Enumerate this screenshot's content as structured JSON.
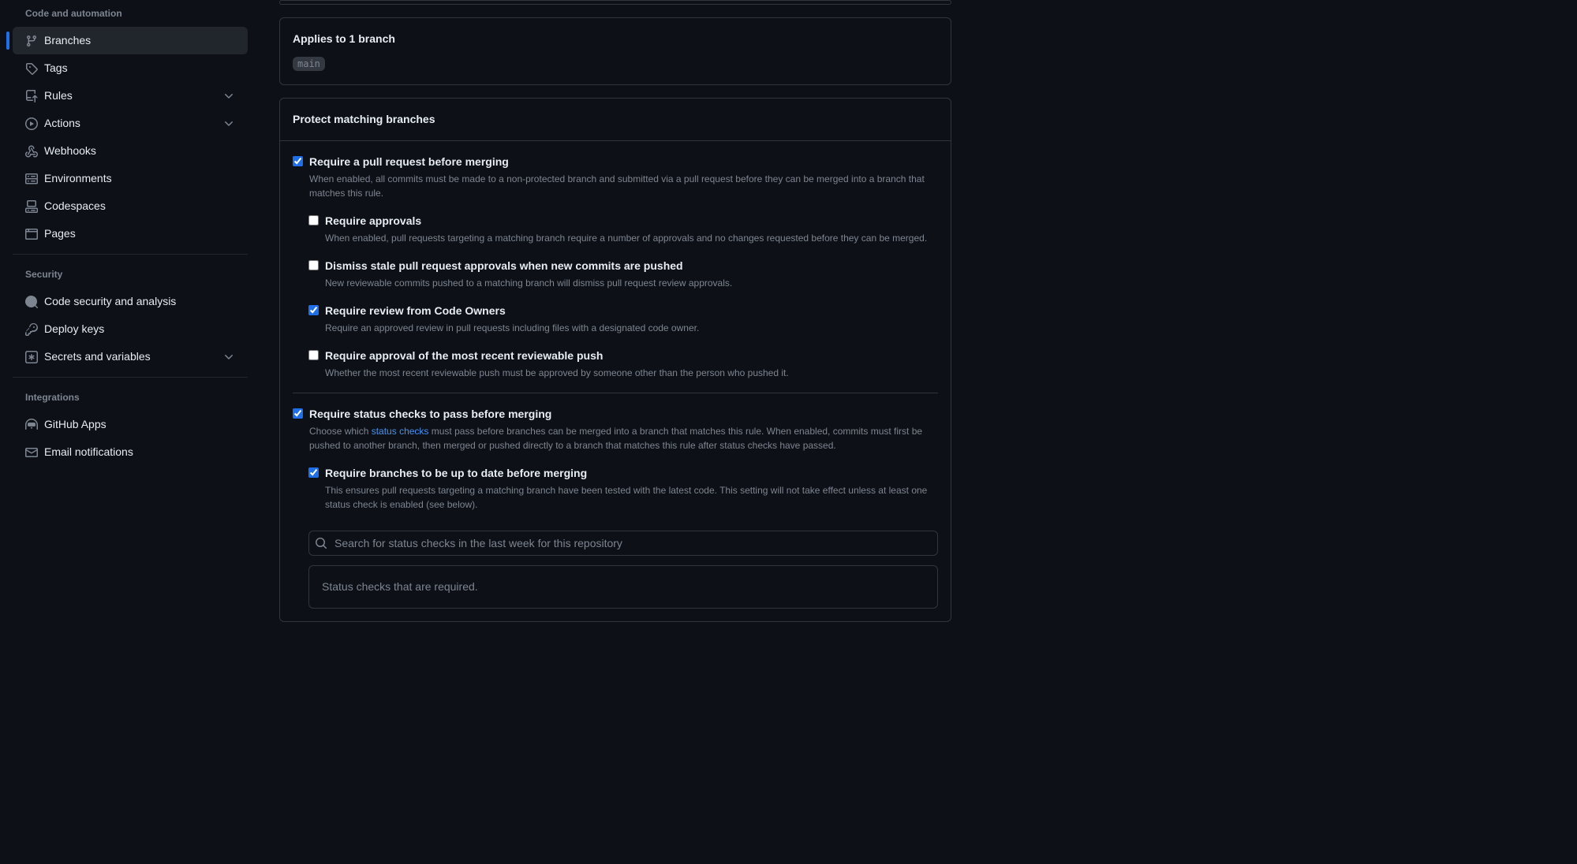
{
  "sidebar": {
    "headings": {
      "code_automation": "Code and automation",
      "security": "Security",
      "integrations": "Integrations"
    },
    "items": {
      "branches": "Branches",
      "tags": "Tags",
      "rules": "Rules",
      "actions": "Actions",
      "webhooks": "Webhooks",
      "environments": "Environments",
      "codespaces": "Codespaces",
      "pages": "Pages",
      "code_security": "Code security and analysis",
      "deploy_keys": "Deploy keys",
      "secrets_vars": "Secrets and variables",
      "github_apps": "GitHub Apps",
      "email_notifications": "Email notifications"
    }
  },
  "applies": {
    "title": "Applies to 1 branch",
    "branch": "main"
  },
  "protect": {
    "header": "Protect matching branches",
    "require_pr": {
      "title": "Require a pull request before merging",
      "desc": "When enabled, all commits must be made to a non-protected branch and submitted via a pull request before they can be merged into a branch that matches this rule."
    },
    "require_approvals": {
      "title": "Require approvals",
      "desc": "When enabled, pull requests targeting a matching branch require a number of approvals and no changes requested before they can be merged."
    },
    "dismiss_stale": {
      "title": "Dismiss stale pull request approvals when new commits are pushed",
      "desc": "New reviewable commits pushed to a matching branch will dismiss pull request review approvals."
    },
    "require_codeowners": {
      "title": "Require review from Code Owners",
      "desc": "Require an approved review in pull requests including files with a designated code owner."
    },
    "require_recent_push": {
      "title": "Require approval of the most recent reviewable push",
      "desc": "Whether the most recent reviewable push must be approved by someone other than the person who pushed it."
    },
    "require_status": {
      "title": "Require status checks to pass before merging",
      "desc_prefix": "Choose which ",
      "desc_link": "status checks",
      "desc_suffix": " must pass before branches can be merged into a branch that matches this rule. When enabled, commits must first be pushed to another branch, then merged or pushed directly to a branch that matches this rule after status checks have passed."
    },
    "require_uptodate": {
      "title": "Require branches to be up to date before merging",
      "desc": "This ensures pull requests targeting a matching branch have been tested with the latest code. This setting will not take effect unless at least one status check is enabled (see below)."
    },
    "search_placeholder": "Search for status checks in the last week for this repository",
    "status_required": "Status checks that are required."
  }
}
